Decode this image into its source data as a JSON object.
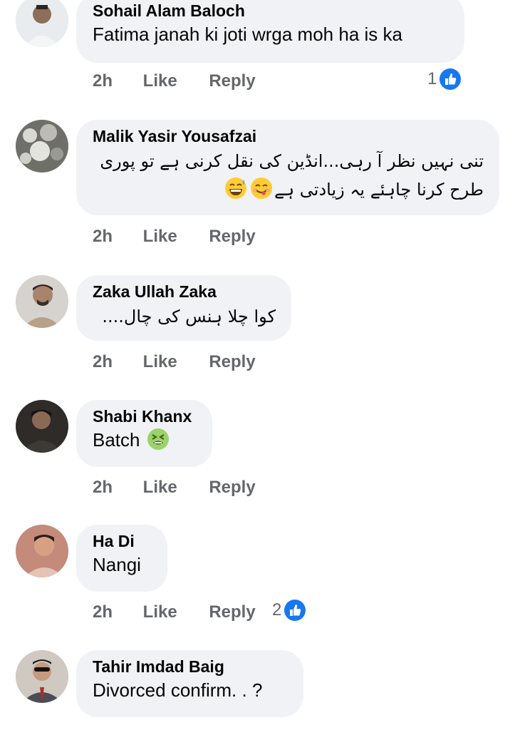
{
  "comments": [
    {
      "author": "Sohail Alam Baloch",
      "text": "Fatima janah ki joti wrga moh ha is ka",
      "time": "2h",
      "like": "Like",
      "reply": "Reply",
      "reactions": "1",
      "avatar": "avatar-photo"
    },
    {
      "author": "Malik Yasir Yousafzai",
      "text_line1": "تنی نہیں نظر آ رہی...انڈین کی نقل کرنی ہے تو پوری",
      "text_line2": "طرح کرنا چاہئے یہ زیادتی ہے",
      "time": "2h",
      "like": "Like",
      "reply": "Reply",
      "emojis": [
        "sweat-smile-emoji",
        "yum-emoji"
      ],
      "avatar": "avatar-photo"
    },
    {
      "author": "Zaka Ullah Zaka",
      "text": "کوا چلا ہنس کی چال....",
      "time": "2h",
      "like": "Like",
      "reply": "Reply",
      "avatar": "avatar-photo"
    },
    {
      "author": "Shabi Khanx",
      "text": "Batch",
      "time": "2h",
      "like": "Like",
      "reply": "Reply",
      "emoji": "nauseated-face-emoji",
      "avatar": "avatar-photo"
    },
    {
      "author": "Ha Di",
      "text": "Nangi",
      "time": "2h",
      "like": "Like",
      "reply": "Reply",
      "reactions": "2",
      "avatar": "avatar-photo"
    },
    {
      "author": "Tahir Imdad Baig",
      "text": "Divorced confirm. . ?",
      "avatar": "avatar-photo"
    }
  ],
  "colors": {
    "bubble": "#f0f2f5",
    "meta": "#65676b",
    "like_blue": "#1877f2"
  },
  "icons": {
    "reaction": "like-thumb-icon"
  }
}
